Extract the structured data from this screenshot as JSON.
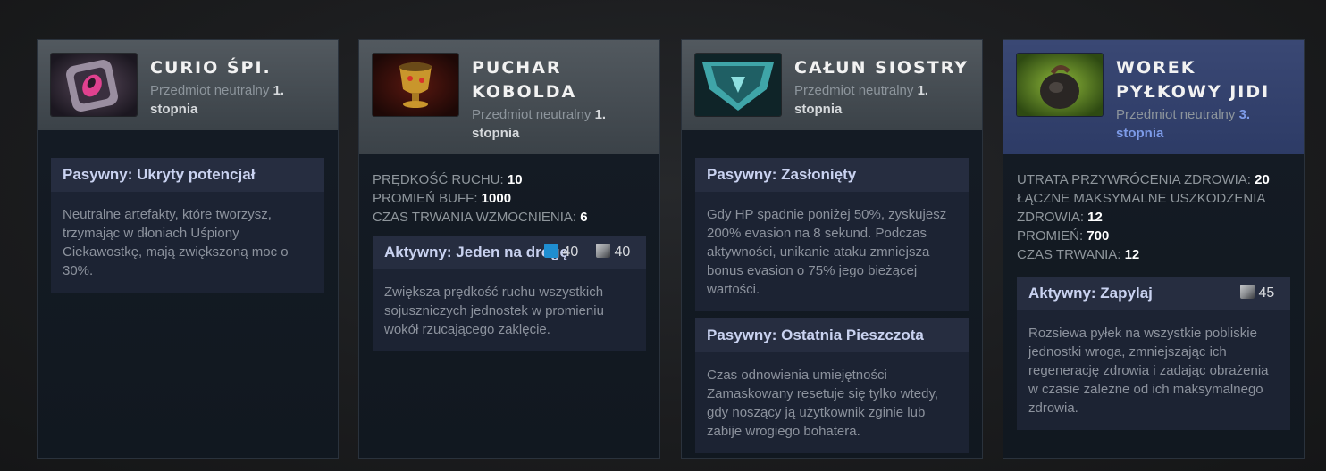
{
  "cards": [
    {
      "title": "CURIO ŚPI.",
      "subtitle_prefix": "Przedmiot neutralny ",
      "subtitle_tier": "1.",
      "subtitle_suffix": "stopnia",
      "ability1": {
        "title": "Pasywny: Ukryty potencjał",
        "desc": "Neutralne artefakty, które tworzysz, trzymając w dłoniach Uśpiony Ciekawostkę, mają zwiększoną moc o 30%."
      }
    },
    {
      "title_line1": "PUCHAR",
      "title_line2": "KOBOLDA",
      "subtitle_prefix": "Przedmiot neutralny ",
      "subtitle_tier": "1.",
      "subtitle_suffix": "stopnia",
      "stats": [
        {
          "label": "PRĘDKOŚĆ RUCHU: ",
          "value": "10"
        },
        {
          "label": "PROMIEŃ BUFF: ",
          "value": "1000"
        },
        {
          "label": "CZAS TRWANIA WZMOCNIENIA: ",
          "value": "6"
        }
      ],
      "ability1": {
        "title": "Aktywny: Jeden na drogę",
        "mana": "40",
        "cooldown": "40",
        "desc": "Zwiększa prędkość ruchu wszystkich sojuszniczych jednostek w promieniu wokół rzucającego zaklęcie."
      }
    },
    {
      "title": "CAŁUN SIOSTRY",
      "subtitle_prefix": "Przedmiot neutralny ",
      "subtitle_tier": "1.",
      "subtitle_suffix": "stopnia",
      "ability1": {
        "title": "Pasywny: Zasłonięty",
        "desc": "Gdy HP spadnie poniżej 50%, zyskujesz 200% evasion na 8 sekund. Podczas aktywności, unikanie ataku zmniejsza bonus evasion o 75% jego bieżącej wartości."
      },
      "ability2": {
        "title": "Pasywny: Ostatnia Pieszczota",
        "desc": "Czas odnowienia umiejętności Zamaskowany resetuje się tylko wtedy, gdy noszący ją użytkownik zginie lub zabije wrogiego bohatera."
      }
    },
    {
      "title_line1": "WOREK",
      "title_line2": "PYŁKOWY JIDI",
      "subtitle_prefix": "Przedmiot neutralny ",
      "subtitle_tier": "3.",
      "subtitle_suffix": "stopnia",
      "stats": [
        {
          "label": "UTRATA PRZYWRÓCENIA ZDROWIA: ",
          "value": "20"
        },
        {
          "label": "ŁĄCZNE MAKSYMALNE USZKODZENIA ZDROWIA: ",
          "value": "12"
        },
        {
          "label": "PROMIEŃ: ",
          "value": "700"
        },
        {
          "label": "CZAS TRWANIA: ",
          "value": "12"
        }
      ],
      "ability1": {
        "title": "Aktywny: Zapylaj",
        "cooldown": "45",
        "desc": "Rozsiewa pyłek na wszystkie pobliskie jednostki wroga, zmniejszając ich regenerację zdrowia i zadając obrażenia w czasie zależne od ich maksymalnego zdrowia."
      }
    }
  ],
  "colors": {
    "tier3_header": "#2d3b66",
    "tier3_text": "#7d9be8",
    "mana": "#1f8ed1"
  },
  "icons": [
    "curio-icon",
    "kobold-cup-icon",
    "sister-shroud-icon",
    "pollen-pouch-icon",
    "mana-icon",
    "cooldown-icon"
  ]
}
